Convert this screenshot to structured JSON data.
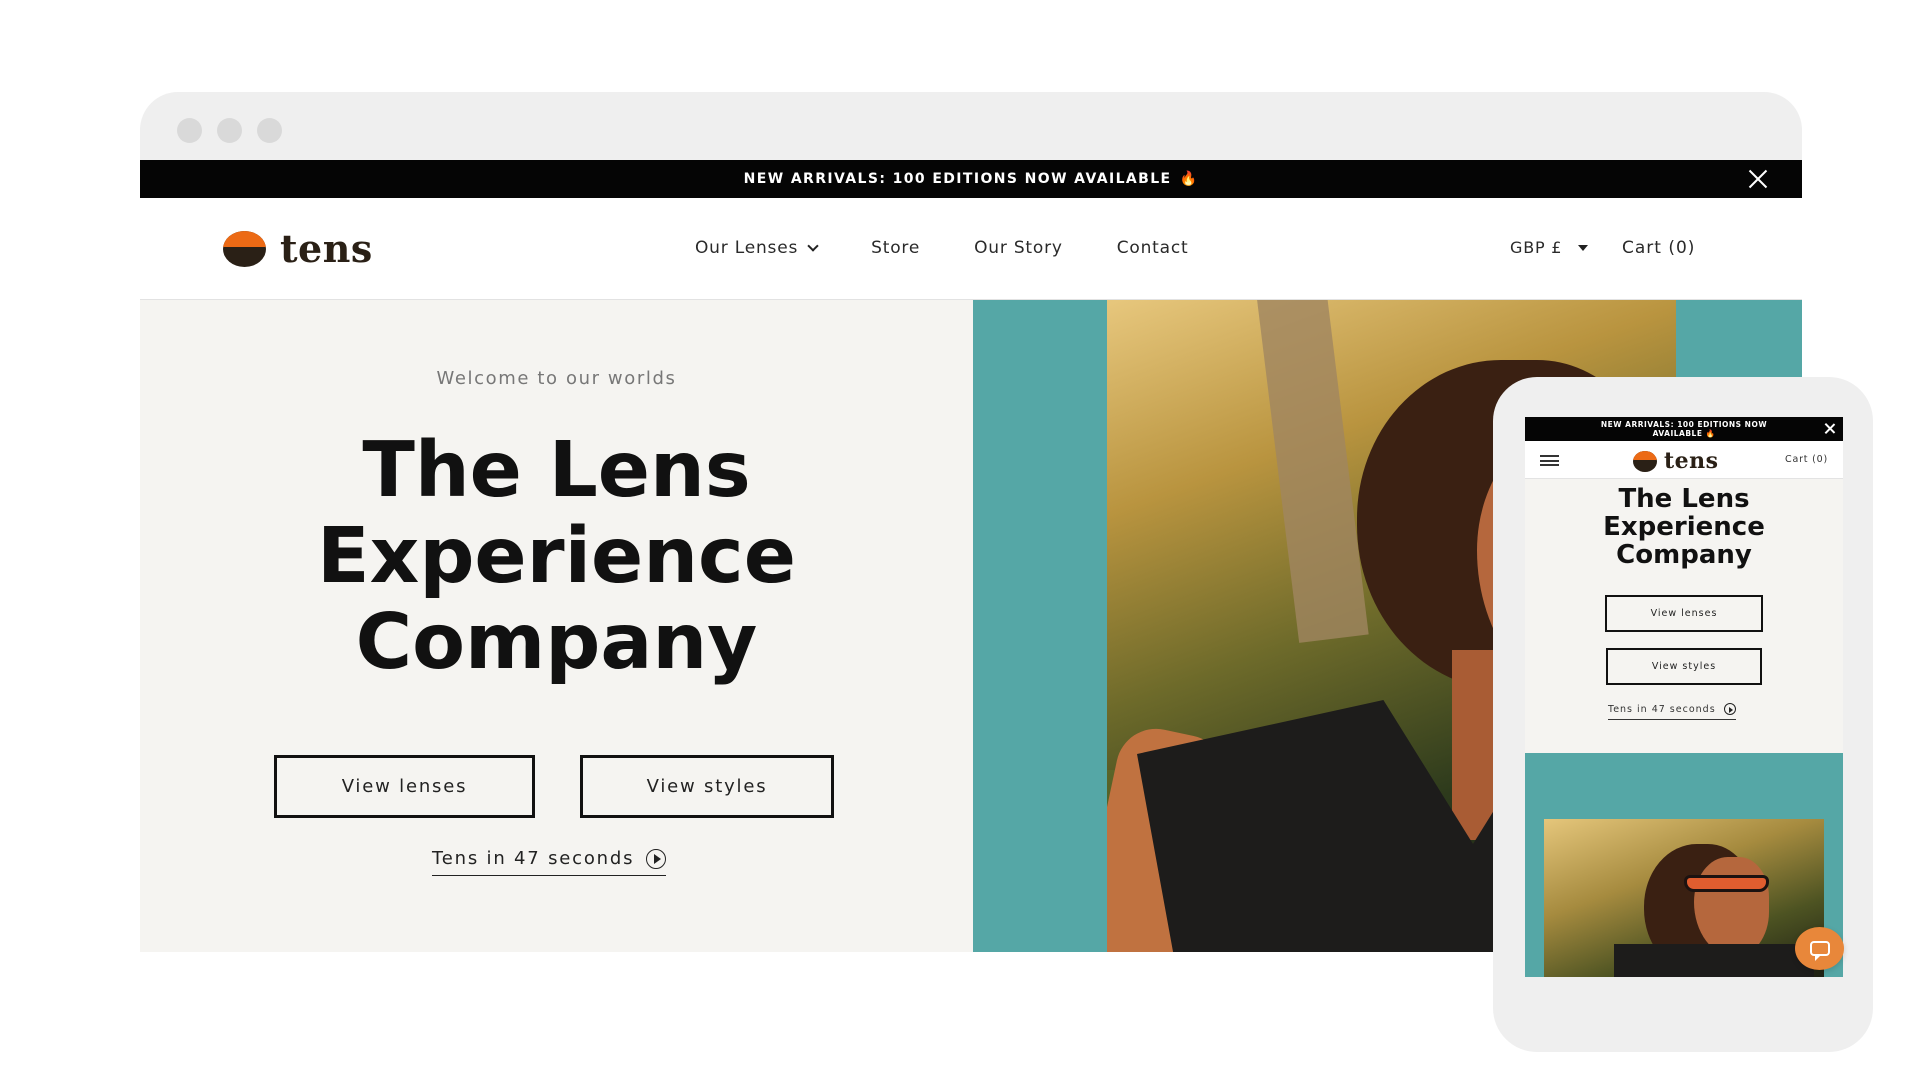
{
  "desktop": {
    "announcement": {
      "text": "NEW ARRIVALS: 100 EDITIONS NOW AVAILABLE",
      "emoji": "🔥"
    },
    "brand": {
      "name": "tens"
    },
    "nav": {
      "our_lenses": "Our Lenses",
      "store": "Store",
      "our_story": "Our Story",
      "contact": "Contact"
    },
    "currency": "GBP £",
    "cart": "Cart (0)",
    "hero": {
      "welcome": "Welcome to our worlds",
      "title_line1": "The Lens",
      "title_line2": "Experience",
      "title_line3": "Company",
      "view_lenses": "View lenses",
      "view_styles": "View styles",
      "video_link": "Tens in 47 seconds"
    }
  },
  "mobile": {
    "announcement": {
      "line1": "NEW ARRIVALS: 100 EDITIONS NOW",
      "line2": "AVAILABLE",
      "emoji": "🔥"
    },
    "brand": {
      "name": "tens"
    },
    "cart": "Cart (0)",
    "hero": {
      "title_line1": "The Lens",
      "title_line2": "Experience",
      "title_line3": "Company",
      "view_lenses": "View lenses",
      "view_styles": "View styles",
      "video_link": "Tens in 47 seconds"
    }
  },
  "colors": {
    "teal": "#55a7a6",
    "brand_orange": "#ec6a15",
    "brand_dark": "#2a2016",
    "hero_background": "#f5f4f1",
    "chat_orange": "#e8873a"
  },
  "icons": [
    "close-icon",
    "chevron-down-icon",
    "caret-down-icon",
    "play-circle-icon",
    "hamburger-menu-icon",
    "chat-icon",
    "logo-mark-icon"
  ]
}
